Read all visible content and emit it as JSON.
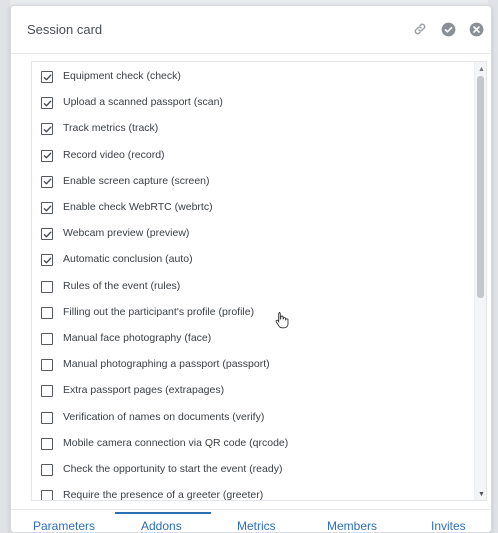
{
  "card": {
    "title": "Session card"
  },
  "header_icons": [
    "link-icon",
    "check-circle-icon",
    "close-circle-icon"
  ],
  "addons": [
    {
      "label": "Equipment check (check)",
      "checked": true
    },
    {
      "label": "Upload a scanned passport (scan)",
      "checked": true
    },
    {
      "label": "Track metrics (track)",
      "checked": true
    },
    {
      "label": "Record video (record)",
      "checked": true
    },
    {
      "label": "Enable screen capture (screen)",
      "checked": true
    },
    {
      "label": "Enable check WebRTC (webrtc)",
      "checked": true
    },
    {
      "label": "Webcam preview (preview)",
      "checked": true
    },
    {
      "label": "Automatic conclusion (auto)",
      "checked": true
    },
    {
      "label": "Rules of the event (rules)",
      "checked": false
    },
    {
      "label": "Filling out the participant's profile (profile)",
      "checked": false
    },
    {
      "label": "Manual face photography (face)",
      "checked": false
    },
    {
      "label": "Manual photographing a passport (passport)",
      "checked": false
    },
    {
      "label": "Extra passport pages (extrapages)",
      "checked": false
    },
    {
      "label": "Verification of names on documents (verify)",
      "checked": false
    },
    {
      "label": "Mobile camera connection via QR code (qrcode)",
      "checked": false
    },
    {
      "label": "Check the opportunity to start the event (ready)",
      "checked": false
    },
    {
      "label": "Require the presence of a greeter (greeter)",
      "checked": false
    }
  ],
  "tabs": [
    {
      "label": "Parameters"
    },
    {
      "label": "Addons",
      "active": true
    },
    {
      "label": "Metrics"
    },
    {
      "label": "Members"
    },
    {
      "label": "Invites"
    }
  ],
  "colors": {
    "accent": "#2e6fb3",
    "text": "#3b4046",
    "icon": "#8a9096"
  }
}
